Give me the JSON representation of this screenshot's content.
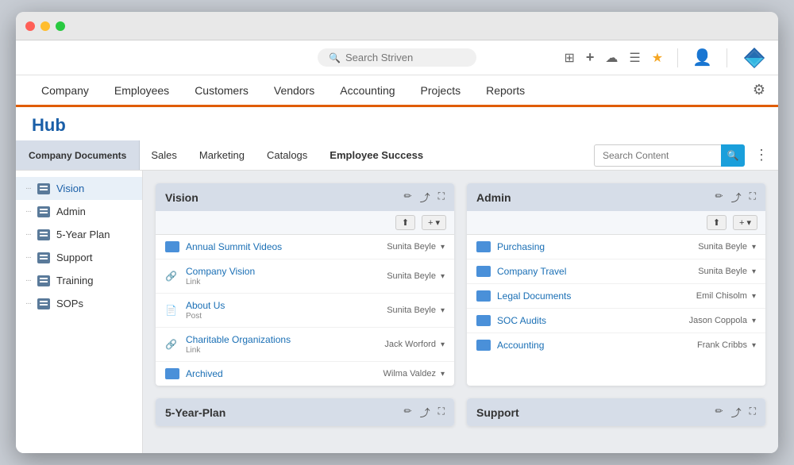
{
  "window": {
    "title": "Striven"
  },
  "toolbar": {
    "search_placeholder": "Search Striven"
  },
  "navbar": {
    "items": [
      {
        "id": "company",
        "label": "Company"
      },
      {
        "id": "employees",
        "label": "Employees"
      },
      {
        "id": "customers",
        "label": "Customers"
      },
      {
        "id": "vendors",
        "label": "Vendors"
      },
      {
        "id": "accounting",
        "label": "Accounting"
      },
      {
        "id": "projects",
        "label": "Projects"
      },
      {
        "id": "reports",
        "label": "Reports"
      }
    ]
  },
  "page": {
    "title": "Hub"
  },
  "tabbar": {
    "tabs": [
      {
        "id": "company-docs",
        "label": "Company Documents",
        "active": true
      },
      {
        "id": "sales",
        "label": "Sales"
      },
      {
        "id": "marketing",
        "label": "Marketing"
      },
      {
        "id": "catalogs",
        "label": "Catalogs"
      },
      {
        "id": "employee-success",
        "label": "Employee Success"
      }
    ],
    "search_placeholder": "Search Content"
  },
  "sidebar": {
    "items": [
      {
        "id": "vision",
        "label": "Vision"
      },
      {
        "id": "admin",
        "label": "Admin"
      },
      {
        "id": "five-year-plan",
        "label": "5-Year Plan"
      },
      {
        "id": "support",
        "label": "Support"
      },
      {
        "id": "training",
        "label": "Training"
      },
      {
        "id": "sops",
        "label": "SOPs"
      }
    ]
  },
  "cards": [
    {
      "id": "vision",
      "title": "Vision",
      "items": [
        {
          "type": "folder",
          "name": "Annual Summit Videos",
          "author": "Sunita Beyle"
        },
        {
          "type": "link",
          "name": "Company Vision",
          "subtype": "Link",
          "author": "Sunita Beyle"
        },
        {
          "type": "doc",
          "name": "About Us",
          "subtype": "Post",
          "author": "Sunita Beyle"
        },
        {
          "type": "link",
          "name": "Charitable Organizations",
          "subtype": "Link",
          "author": "Jack Worford"
        },
        {
          "type": "folder",
          "name": "Archived",
          "author": "Wilma Valdez"
        }
      ]
    },
    {
      "id": "admin",
      "title": "Admin",
      "items": [
        {
          "type": "folder",
          "name": "Purchasing",
          "author": "Sunita Beyle"
        },
        {
          "type": "folder",
          "name": "Company Travel",
          "author": "Sunita Beyle"
        },
        {
          "type": "folder",
          "name": "Legal Documents",
          "author": "Emil Chisolm"
        },
        {
          "type": "folder",
          "name": "SOC Audits",
          "author": "Jason Coppola"
        },
        {
          "type": "folder",
          "name": "Accounting",
          "author": "Frank Cribbs"
        }
      ]
    }
  ],
  "bottom_cards": [
    {
      "id": "five-year-plan",
      "title": "5-Year-Plan"
    },
    {
      "id": "support-card",
      "title": "Support"
    }
  ]
}
